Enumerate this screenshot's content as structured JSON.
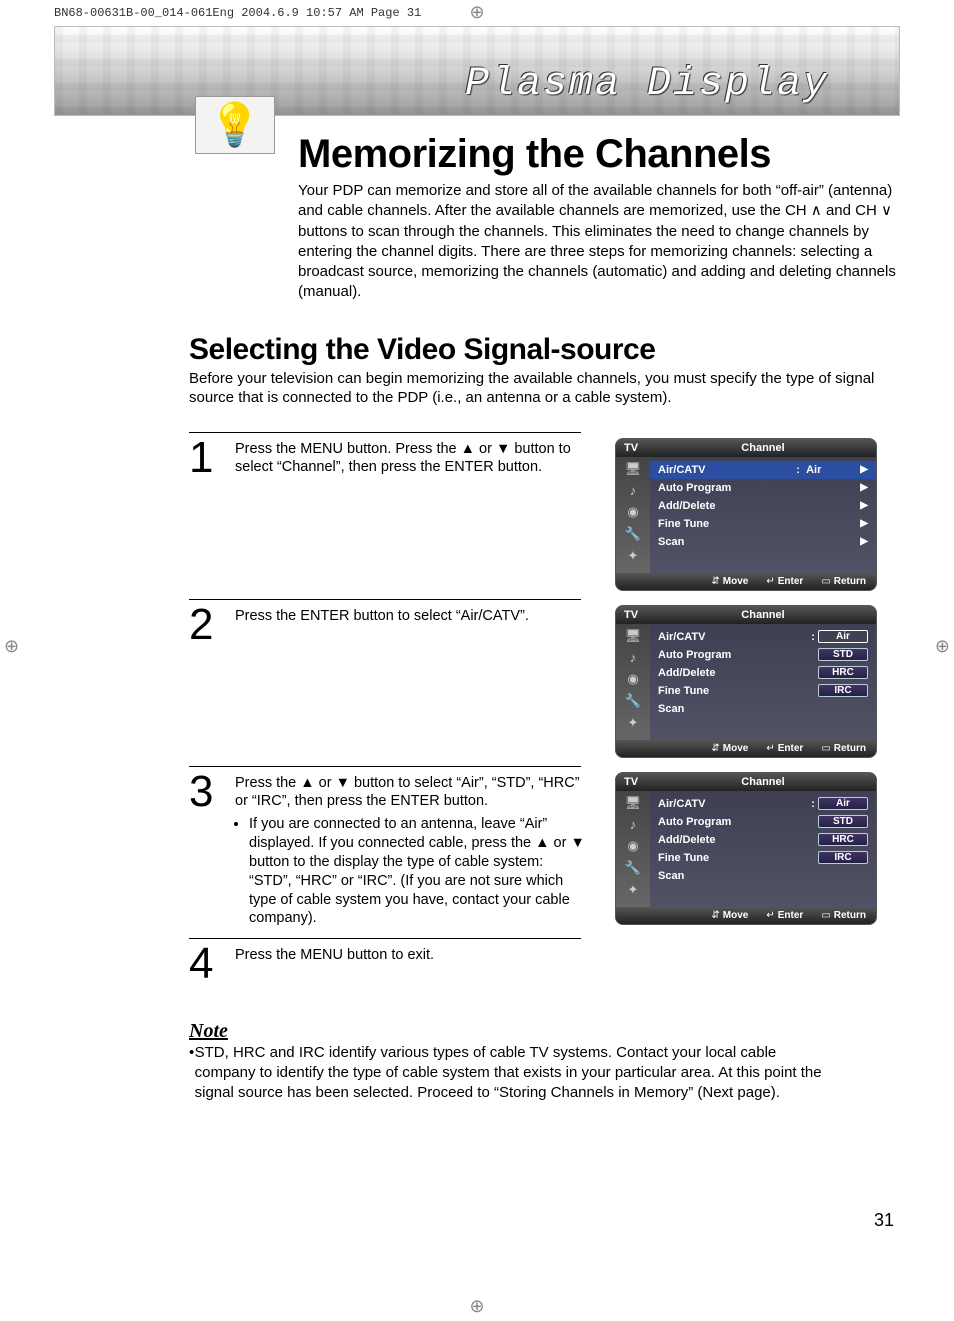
{
  "print_tag": "BN68-00631B-00_014-061Eng  2004.6.9  10:57 AM  Page 31",
  "banner_title": "Plasma Display",
  "main_title": "Memorizing the Channels",
  "intro": "Your PDP can memorize and store all of the available channels for both “off-air” (antenna) and cable channels. After the available channels are memorized, use the CH ∧ and CH ∨ buttons to scan through the channels. This eliminates the need to change channels by entering the channel digits. There are three steps for memorizing channels: selecting a broadcast source, memorizing the channels (automatic) and adding and deleting channels (manual).",
  "subhead": "Selecting the Video Signal-source",
  "subintro": "Before your television can begin memorizing the available channels, you must specify the type of signal source that is connected to the PDP (i.e., an antenna or a cable system).",
  "steps": [
    {
      "num": "1",
      "text": "Press the MENU button. Press the ▲ or ▼ button to select “Channel”, then press the ENTER button."
    },
    {
      "num": "2",
      "text": "Press the ENTER button to select “Air/CATV”."
    },
    {
      "num": "3",
      "text": "Press the ▲ or ▼ button to select  “Air”, “STD”, “HRC” or “IRC”, then press the ENTER button.",
      "bullets": [
        "If you are connected to an antenna, leave “Air” displayed. If you connected cable, press the ▲ or ▼ button to the display the type of cable system: “STD”, “HRC” or “IRC”. (If you are not sure which type of cable system you have, contact your cable company)."
      ]
    },
    {
      "num": "4",
      "text": "Press the MENU button to exit."
    }
  ],
  "osd_common": {
    "tv": "TV",
    "title": "Channel",
    "foot_move": "Move",
    "foot_enter": "Enter",
    "foot_return": "Return",
    "items": {
      "aircatv": "Air/CATV",
      "autoprog": "Auto Program",
      "adddel": "Add/Delete",
      "finetune": "Fine Tune",
      "scan": "Scan"
    },
    "sep": ":",
    "val_air": "Air",
    "opt_air": "Air",
    "opt_std": "STD",
    "opt_hrc": "HRC",
    "opt_irc": "IRC"
  },
  "note_head": "Note",
  "note_body": "STD, HRC and IRC identify various types of cable TV systems. Contact your local cable company to identify the type of cable system that exists in your particular area. At this point the signal source has been selected. Proceed to “Storing Channels in Memory” (Next page).",
  "page_number": "31"
}
